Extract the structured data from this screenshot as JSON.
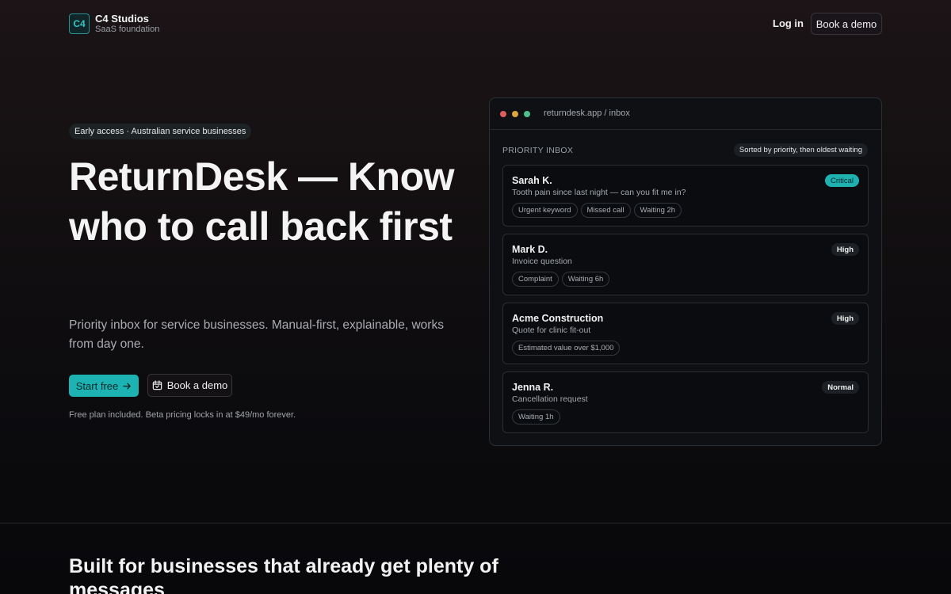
{
  "header": {
    "logo_mark": "C4",
    "brand_name": "C4 Studios",
    "brand_sub": "SaaS foundation",
    "login_label": "Log in",
    "demo_label": "Book a demo"
  },
  "hero": {
    "badge": "Early access · Australian service businesses",
    "title": "ReturnDesk — Know who to call back first",
    "subtitle": "Priority inbox for service businesses. Manual-first, explainable, works from day one.",
    "start_label": "Start free",
    "demo_label": "Book a demo",
    "fine_print": "Free plan included. Beta pricing locks in at $49/mo forever."
  },
  "app_window": {
    "url": "returndesk.app / inbox",
    "inbox_label": "PRIORITY INBOX",
    "sort_label": "Sorted by priority, then oldest waiting",
    "cards": [
      {
        "name": "Sarah K.",
        "desc": "Tooth pain since last night — can you fit me in?",
        "priority": "Critical",
        "tags": [
          "Urgent keyword",
          "Missed call",
          "Waiting 2h"
        ]
      },
      {
        "name": "Mark D.",
        "desc": "Invoice question",
        "priority": "High",
        "tags": [
          "Complaint",
          "Waiting 6h"
        ]
      },
      {
        "name": "Acme Construction",
        "desc": "Quote for clinic fit-out",
        "priority": "High",
        "tags": [
          "Estimated value over $1,000"
        ]
      },
      {
        "name": "Jenna R.",
        "desc": "Cancellation request",
        "priority": "Normal",
        "tags": [
          "Waiting 1h"
        ]
      }
    ]
  },
  "section": {
    "title": "Built for businesses that already get plenty of messages"
  },
  "colors": {
    "accent": "#1eb3b3",
    "background": "#0c0b0e",
    "traffic_red": "#e05d5d",
    "traffic_yellow": "#d9a640",
    "traffic_green": "#4ec08e"
  },
  "icons": {
    "start_button": "arrow-right-icon",
    "demo_button": "calendar-icon"
  }
}
